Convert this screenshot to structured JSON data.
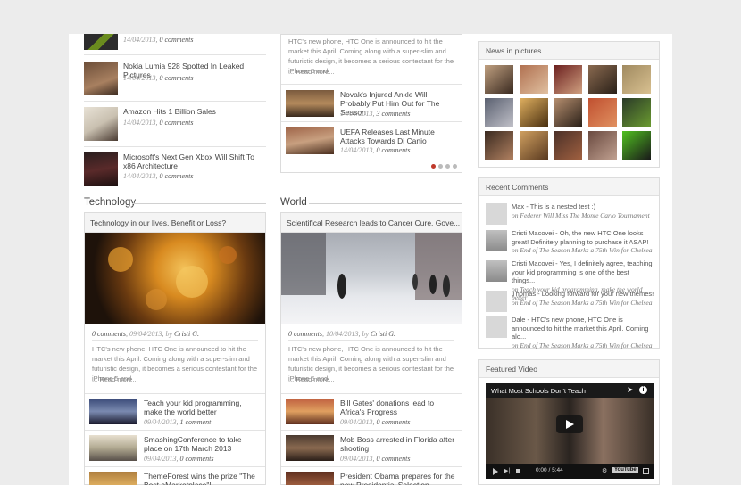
{
  "left_col": {
    "top_list": [
      {
        "date": "14/04/2013",
        "comments": "0 comments"
      },
      {
        "title": "Nokia Lumia 928 Spotted In Leaked Pictures",
        "date": "14/04/2013",
        "comments": "0 comments"
      },
      {
        "title": "Amazon Hits 1 Billion Sales",
        "date": "14/04/2013",
        "comments": "0 comments"
      },
      {
        "title": "Microsoft's Next Gen Xbox Will Shift To x86 Architecture",
        "date": "14/04/2013",
        "comments": "0 comments"
      }
    ]
  },
  "mid_col": {
    "excerpt_top": "HTC's new phone, HTC One is announced to hit the market this April. Coming along with a super-slim and futuristic design, it becomes a serious contestant for the iPhone 5 and",
    "read_more": "... Read more...",
    "list": [
      {
        "title": "Novak's Injured Ankle Will Probably Put Him Out for The Season",
        "date": "14/04/2013",
        "comments": "3 comments"
      },
      {
        "title": "UEFA Releases Last Minute Attacks Towards Di Canio",
        "date": "14/04/2013",
        "comments": "0 comments"
      }
    ]
  },
  "technology": {
    "section": "Technology",
    "feature_title": "Technology in our lives. Benefit or Loss?",
    "meta_comments": "0 comments",
    "meta_date": "09/04/2013",
    "meta_by": "by",
    "meta_author": "Cristi G.",
    "excerpt": "HTC's new phone, HTC One is announced to hit the market this April. Coming along with a super-slim and futuristic design, it becomes a serious contestant for the iPhone 5 and",
    "read_more": "... Read more...",
    "list": [
      {
        "title": "Teach your kid programming, make the world better",
        "date": "09/04/2013",
        "comments": "1 comment"
      },
      {
        "title": "SmashingConference to take place on 17th March 2013",
        "date": "09/04/2013",
        "comments": "0 comments"
      },
      {
        "title": "ThemeForest wins the prize \"The Best eMarketplace\"!",
        "date": "",
        "comments": ""
      }
    ]
  },
  "world": {
    "section": "World",
    "feature_title": "Scientifical Research leads to Cancer Cure, Gove...",
    "meta_comments": "0 comments",
    "meta_date": "10/04/2013",
    "meta_by": "by",
    "meta_author": "Cristi G.",
    "excerpt": "HTC's new phone, HTC One is announced to hit the market this April. Coming along with a super-slim and futuristic design, it becomes a serious contestant for the iPhone 5 and",
    "read_more": "... Read more...",
    "list": [
      {
        "title": "Bill Gates' donations lead to Africa's Progress",
        "date": "09/04/2013",
        "comments": "0 comments"
      },
      {
        "title": "Mob Boss arrested in Florida after shooting",
        "date": "09/04/2013",
        "comments": "0 comments"
      },
      {
        "title": "President Obama prepares for the new Presidential Selection",
        "date": "",
        "comments": ""
      }
    ]
  },
  "sidebar": {
    "news_in_pictures": "News in pictures",
    "recent_comments": "Recent Comments",
    "comments": [
      {
        "text": "Max - This is a nested test :)",
        "on": "on",
        "post": "Federer Will Miss The Monte Carlo Tournament"
      },
      {
        "text": "Cristi Macovei - Oh, the new HTC One looks great! Definitely planning to purchase it ASAP!",
        "on": "on",
        "post": "End of The Season Marks a 75th Win for Chelsea"
      },
      {
        "text": "Cristi Macovei - Yes, I definitely agree, teaching your kid programming is one of the best things...",
        "on": "on",
        "post": "Teach your kid programming, make the world better"
      },
      {
        "text": "Thomas - Looking forward for your new themes!",
        "on": "on",
        "post": "End of The Season Marks a 75th Win for Chelsea"
      },
      {
        "text": "Dale - HTC's new phone, HTC One is announced to hit the market this April. Coming alo...",
        "on": "on",
        "post": "End of The Season Marks a 75th Win for Chelsea"
      }
    ],
    "featured_video": "Featured Video",
    "video": {
      "title": "What Most Schools Don't Teach",
      "time": "0:00 / 5:44",
      "brand": "YouTube"
    }
  },
  "colors": {
    "accent": "#c0392b",
    "dot_inactive": "#bbbbbb"
  }
}
